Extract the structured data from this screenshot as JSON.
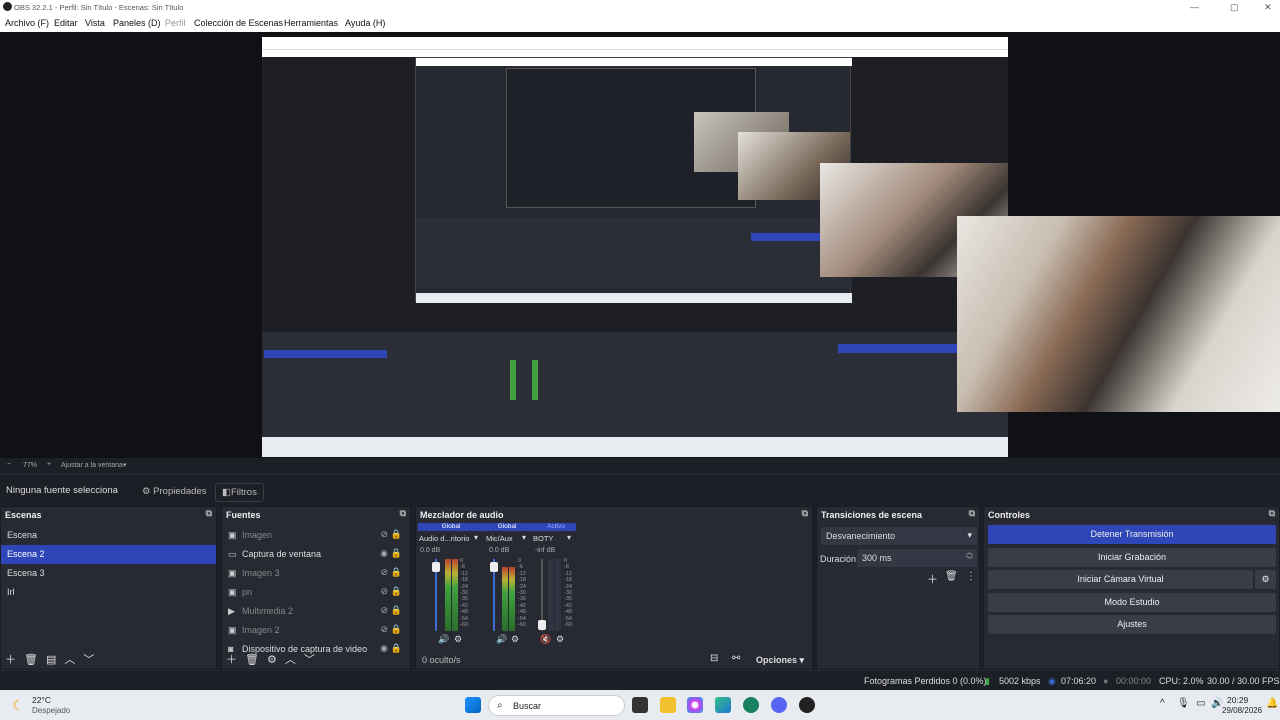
{
  "window": {
    "title": "OBS 32.2.1 - Perfil: Sin Título - Escenas: Sin Título",
    "min": "—",
    "max": "▢",
    "close": "✕"
  },
  "menu": [
    "Archivo (F)",
    "Editar",
    "Vista",
    "Paneles (D)",
    "Perfil",
    "Colección de Escenas",
    "Herramientas",
    "Ayuda (H)"
  ],
  "zoom": {
    "minus": "−",
    "value": "77%",
    "plus": "+",
    "fit": "Ajustar a la ventana"
  },
  "context": {
    "no_source": "Ninguna fuente selecciona",
    "properties": "Propiedades",
    "filters": "Filtros"
  },
  "scenes": {
    "title": "Escenas",
    "items": [
      {
        "label": "Escena",
        "selected": false
      },
      {
        "label": "Escena 2",
        "selected": true
      },
      {
        "label": "Escena 3",
        "selected": false
      },
      {
        "label": "Irl",
        "selected": false
      }
    ]
  },
  "sources": {
    "title": "Fuentes",
    "items": [
      {
        "label": "Imagen",
        "icon": "image-icon",
        "visible": false
      },
      {
        "label": "Captura de ventana",
        "icon": "window-icon",
        "visible": true
      },
      {
        "label": "Imagen 3",
        "icon": "image-icon",
        "visible": false
      },
      {
        "label": "pn",
        "icon": "image-icon",
        "visible": false
      },
      {
        "label": "Multimedia 2",
        "icon": "play-icon",
        "visible": false
      },
      {
        "label": "Imagen 2",
        "icon": "image-icon",
        "visible": false
      },
      {
        "label": "Dispositivo de captura de video",
        "icon": "camera-icon",
        "visible": true
      }
    ]
  },
  "mixer": {
    "title": "Mezclador de audio",
    "tags": [
      "Global",
      "Global",
      "Activo"
    ],
    "channels": [
      {
        "name": "Audio d...ritorio",
        "db": "0.0 dB"
      },
      {
        "name": "Mic/Aux",
        "db": "0.0 dB"
      },
      {
        "name": "BOTY",
        "db": "-inf dB"
      }
    ],
    "scale": [
      "0",
      "-6",
      "-12",
      "-18",
      "-24",
      "-30",
      "-36",
      "-42",
      "-48",
      "-54",
      "-60"
    ],
    "hidden": "0 oculto/s",
    "options": "Opciones"
  },
  "transitions": {
    "title": "Transiciones de escena",
    "selected": "Desvanecimiento",
    "duration_label": "Duración",
    "duration": "300 ms"
  },
  "controls": {
    "title": "Controles",
    "buttons": [
      "Detener Transmisión",
      "Iniciar Grabación",
      "Iniciar Cámara Virtual",
      "Modo Estudio",
      "Ajustes"
    ]
  },
  "status": {
    "dropped": "Fotogramas Perdidos 0 (0.0%)",
    "kbps": "5002 kbps",
    "stream_time": "07:06:20",
    "rec_time": "00:00:00",
    "cpu": "CPU: 2.0%",
    "fps": "30.00 / 30.00 FPS"
  },
  "taskbar": {
    "temp": "22°C",
    "weather": "Despejado",
    "search": "Buscar",
    "time": "20:29",
    "date": "29/08/2026"
  },
  "colors": {
    "accent": "#2f46b8",
    "live": "#3fa13f"
  }
}
